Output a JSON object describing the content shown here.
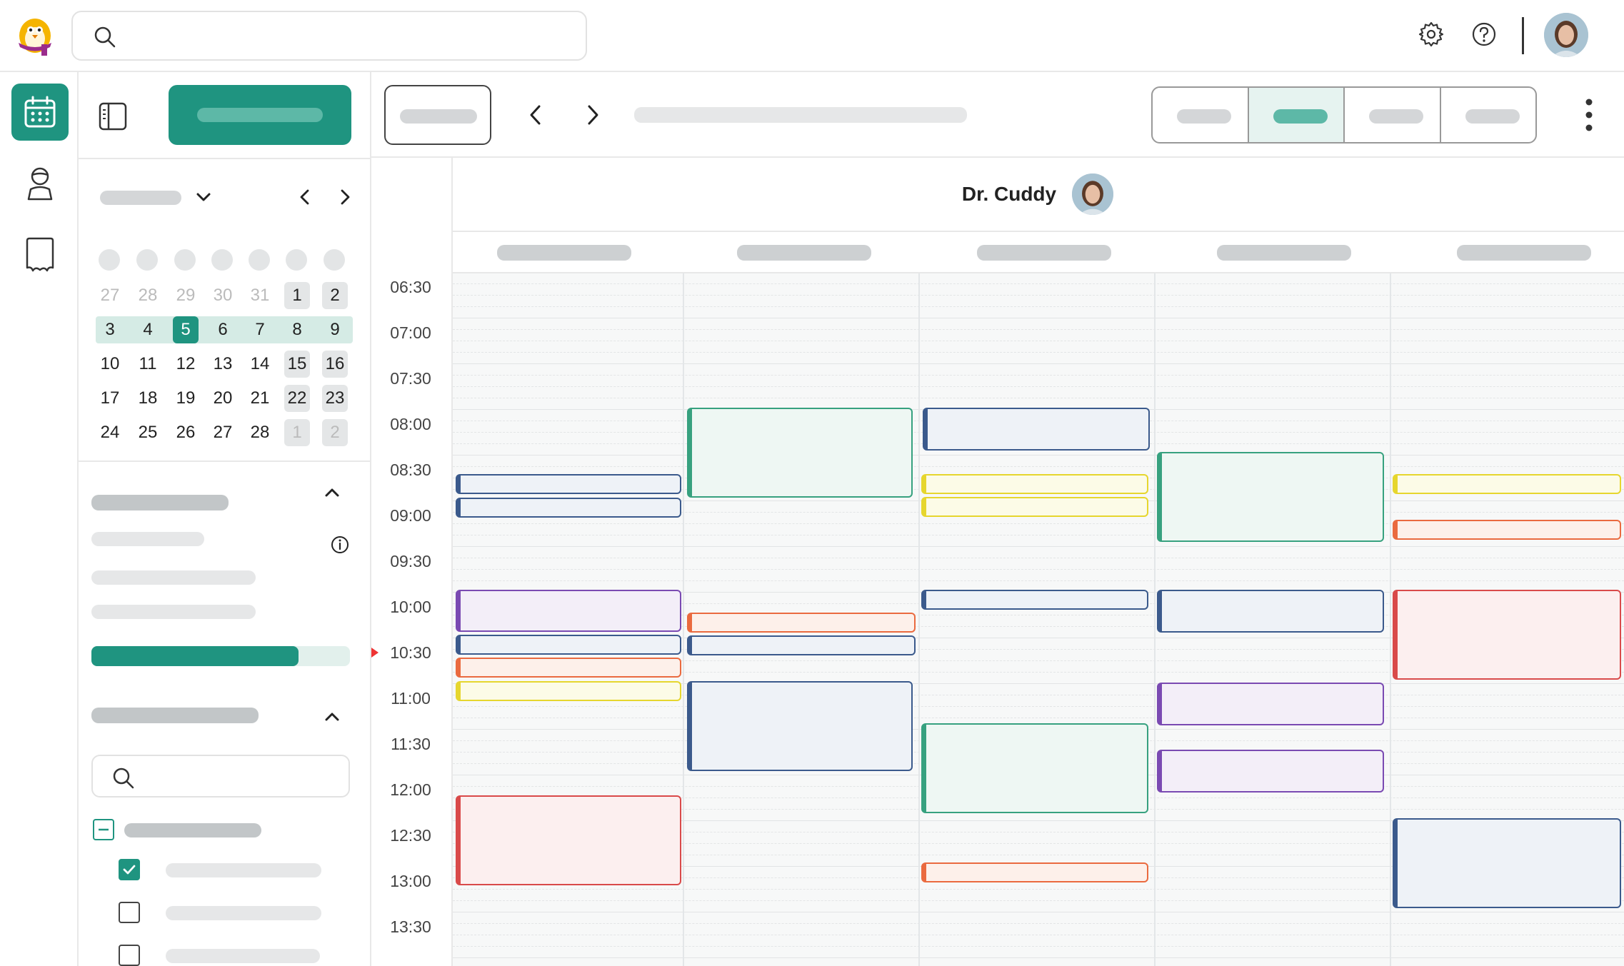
{
  "app": {
    "logo_icon": "penguin-logo",
    "search": {
      "placeholder": ""
    },
    "topbar_icons": [
      "gear-icon",
      "help-icon",
      "user-avatar"
    ]
  },
  "nav": {
    "items": [
      {
        "icon": "calendar-icon",
        "active": true
      },
      {
        "icon": "user-icon",
        "active": false
      },
      {
        "icon": "bookmark-icon",
        "active": false
      }
    ]
  },
  "mini_calendar": {
    "days": [
      [
        "27",
        "28",
        "29",
        "30",
        "31",
        "1",
        "2"
      ],
      [
        "3",
        "4",
        "5",
        "6",
        "7",
        "8",
        "9"
      ],
      [
        "10",
        "11",
        "12",
        "13",
        "14",
        "15",
        "16"
      ],
      [
        "17",
        "18",
        "19",
        "20",
        "21",
        "22",
        "23"
      ],
      [
        "24",
        "25",
        "26",
        "27",
        "28",
        "1",
        "2"
      ]
    ],
    "selected": "5"
  },
  "filters": {
    "progress_fraction": 0.8
  },
  "calendar": {
    "doctor": "Dr. Cuddy",
    "times": [
      "06:30",
      "07:00",
      "07:30",
      "08:00",
      "08:30",
      "09:00",
      "09:30",
      "10:00",
      "10:30",
      "11:00",
      "11:30",
      "12:00",
      "12:30",
      "13:00",
      "13:30"
    ]
  },
  "colors": {
    "accent": "#1f9480",
    "blue": "#3b5a8c",
    "green": "#37a17f",
    "yellow": "#e6d62e",
    "orange": "#ea6a3f",
    "purple": "#7a4ab2",
    "red": "#d94a4a"
  }
}
